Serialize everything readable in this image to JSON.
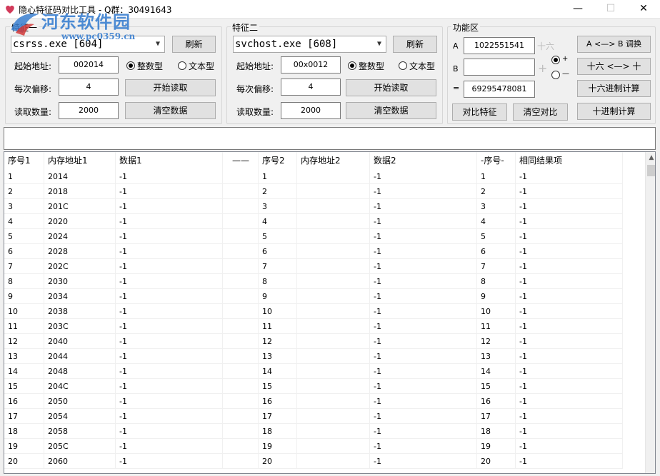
{
  "window": {
    "title": "隐心特征码对比工具 - Q群：30491643",
    "minimize": "—",
    "maximize": "☐",
    "close": "✕"
  },
  "watermark": {
    "text": "河东软件园",
    "url": "www.pc0359.cn"
  },
  "group1": {
    "label": "特征一",
    "process": "csrss.exe [604]",
    "refresh": "刷新",
    "start_label": "起始地址:",
    "start_value": "002014",
    "radio_int": "整数型",
    "radio_text": "文本型",
    "offset_label": "每次偏移:",
    "offset_value": "4",
    "read_button": "开始读取",
    "count_label": "读取数量:",
    "count_value": "2000",
    "clear_button": "清空数据"
  },
  "group2": {
    "label": "特征二",
    "process": "svchost.exe [608]",
    "refresh": "刷新",
    "start_label": "起始地址:",
    "start_value": "00x0012",
    "radio_int": "整数型",
    "radio_text": "文本型",
    "offset_label": "每次偏移:",
    "offset_value": "4",
    "read_button": "开始读取",
    "count_label": "读取数量:",
    "count_value": "2000",
    "clear_button": "清空数据"
  },
  "func": {
    "label": "功能区",
    "a_label": "A",
    "a_value": "1022551541",
    "hex_hint": "十六",
    "b_label": "B",
    "b_value": "",
    "plus_hint": "+",
    "eq_label": "=",
    "result_value": "69295478081",
    "radio_plus": "+",
    "radio_minus": "—",
    "swap_button": "A <—> B 调换",
    "hex_dec_button": "十六 <—> 十",
    "hex_calc_button": "十六进制计算",
    "dec_calc_button": "十进制计算",
    "compare_button": "对比特征",
    "clear_compare_button": "清空对比"
  },
  "table": {
    "headers": [
      "序号1",
      "内存地址1",
      "数据1",
      "——",
      "序号2",
      "内存地址2",
      "数据2",
      "-序号-",
      "相同结果项"
    ],
    "rows": [
      [
        "1",
        "2014",
        "-1",
        "",
        "1",
        "",
        "-1",
        "1",
        "-1"
      ],
      [
        "2",
        "2018",
        "-1",
        "",
        "2",
        "",
        "-1",
        "2",
        "-1"
      ],
      [
        "3",
        "201C",
        "-1",
        "",
        "3",
        "",
        "-1",
        "3",
        "-1"
      ],
      [
        "4",
        "2020",
        "-1",
        "",
        "4",
        "",
        "-1",
        "4",
        "-1"
      ],
      [
        "5",
        "2024",
        "-1",
        "",
        "5",
        "",
        "-1",
        "5",
        "-1"
      ],
      [
        "6",
        "2028",
        "-1",
        "",
        "6",
        "",
        "-1",
        "6",
        "-1"
      ],
      [
        "7",
        "202C",
        "-1",
        "",
        "7",
        "",
        "-1",
        "7",
        "-1"
      ],
      [
        "8",
        "2030",
        "-1",
        "",
        "8",
        "",
        "-1",
        "8",
        "-1"
      ],
      [
        "9",
        "2034",
        "-1",
        "",
        "9",
        "",
        "-1",
        "9",
        "-1"
      ],
      [
        "10",
        "2038",
        "-1",
        "",
        "10",
        "",
        "-1",
        "10",
        "-1"
      ],
      [
        "11",
        "203C",
        "-1",
        "",
        "11",
        "",
        "-1",
        "11",
        "-1"
      ],
      [
        "12",
        "2040",
        "-1",
        "",
        "12",
        "",
        "-1",
        "12",
        "-1"
      ],
      [
        "13",
        "2044",
        "-1",
        "",
        "13",
        "",
        "-1",
        "13",
        "-1"
      ],
      [
        "14",
        "2048",
        "-1",
        "",
        "14",
        "",
        "-1",
        "14",
        "-1"
      ],
      [
        "15",
        "204C",
        "-1",
        "",
        "15",
        "",
        "-1",
        "15",
        "-1"
      ],
      [
        "16",
        "2050",
        "-1",
        "",
        "16",
        "",
        "-1",
        "16",
        "-1"
      ],
      [
        "17",
        "2054",
        "-1",
        "",
        "17",
        "",
        "-1",
        "17",
        "-1"
      ],
      [
        "18",
        "2058",
        "-1",
        "",
        "18",
        "",
        "-1",
        "18",
        "-1"
      ],
      [
        "19",
        "205C",
        "-1",
        "",
        "19",
        "",
        "-1",
        "19",
        "-1"
      ],
      [
        "20",
        "2060",
        "-1",
        "",
        "20",
        "",
        "-1",
        "20",
        "-1"
      ]
    ]
  },
  "colors": {
    "accent": "#3a7fd0",
    "watermark_red": "#d23a3a"
  }
}
